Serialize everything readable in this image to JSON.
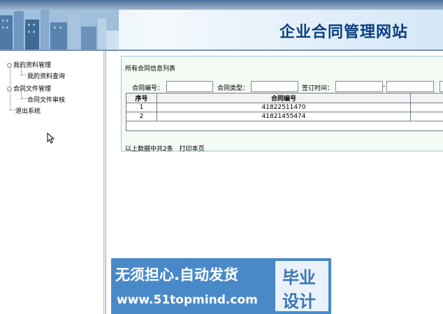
{
  "header": {
    "site_title": "企业合同管理网站"
  },
  "sidebar": {
    "items": [
      {
        "label": "我的资料管理",
        "level": 0
      },
      {
        "label": "我的资料查询",
        "level": 1
      },
      {
        "label": "合同文件管理",
        "level": 0
      },
      {
        "label": "合同文件审核",
        "level": 1
      },
      {
        "label": "退出系统",
        "level": 0
      }
    ]
  },
  "panel": {
    "title": "所有合同信息列表",
    "search": {
      "contract_no_label": "合同编号：",
      "contract_no_value": "",
      "contract_type_label": "合同类型：",
      "contract_type_value": "",
      "sign_time_label": "签订时间：",
      "sign_time_from": "",
      "sign_time_to": "",
      "date_separator": "-"
    },
    "table": {
      "headers": [
        "序号",
        "合同编号"
      ],
      "rows": [
        [
          "1",
          "41822511470"
        ],
        [
          "2",
          "41821455474"
        ]
      ]
    },
    "footer": {
      "summary": "以上数据中共2条",
      "print_label": "打印本页"
    }
  },
  "watermark": {
    "line1": "无须担心.自动发货",
    "line2": "www.51topmind.com",
    "right_line1": "毕业",
    "right_line2": "设计"
  }
}
